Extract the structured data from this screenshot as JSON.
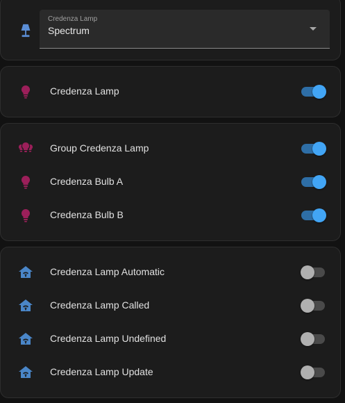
{
  "colors": {
    "bulb_icon": "#9c1f5a",
    "automation_icon": "#4a86c8",
    "lamp_icon": "#5b8ed6",
    "toggle_on": "#42a5f5",
    "toggle_off": "#b0b0b0"
  },
  "select": {
    "label": "Credenza Lamp",
    "value": "Spectrum",
    "icon": "desk-lamp-icon"
  },
  "lamp": {
    "label": "Credenza Lamp",
    "icon": "lightbulb-icon",
    "state": "on"
  },
  "group": {
    "items": [
      {
        "label": "Group Credenza Lamp",
        "icon": "lightbulb-group-icon",
        "state": "on"
      },
      {
        "label": "Credenza Bulb A",
        "icon": "lightbulb-icon",
        "state": "on"
      },
      {
        "label": "Credenza Bulb B",
        "icon": "lightbulb-icon",
        "state": "on"
      }
    ]
  },
  "automations": {
    "items": [
      {
        "label": "Credenza Lamp Automatic",
        "icon": "home-automation-icon",
        "state": "off"
      },
      {
        "label": "Credenza Lamp Called",
        "icon": "home-automation-icon",
        "state": "off"
      },
      {
        "label": "Credenza Lamp Undefined",
        "icon": "home-automation-icon",
        "state": "off"
      },
      {
        "label": "Credenza Lamp Update",
        "icon": "home-automation-icon",
        "state": "off"
      }
    ]
  }
}
